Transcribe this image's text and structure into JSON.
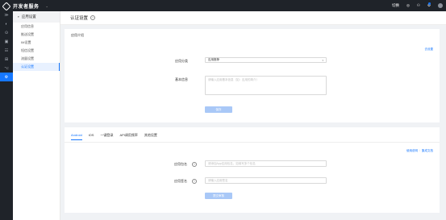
{
  "topbar": {
    "app_title": "开发者服务",
    "project_chevron": "⌄",
    "right_items": [
      "切换",
      "◎",
      "⚇",
      "⚙",
      "◍"
    ]
  },
  "rail": {
    "icons": [
      "≫",
      "◐",
      "⊙",
      "▣",
      "☷",
      "⊞",
      "⌥",
      "⚙"
    ],
    "active_index": 7
  },
  "sidenav": {
    "header": "应用设置",
    "items": [
      "应用信息",
      "推送设置",
      "IM设置",
      "短信设置",
      "流量设置",
      "认证设置"
    ],
    "active_index": 5
  },
  "page": {
    "title": "认证设置",
    "help": "?"
  },
  "card1": {
    "title": "应用介绍",
    "top_right_link": "去设置",
    "category_label": "应用分类",
    "category_value": "应用推荐",
    "desc_label": "基本信息",
    "desc_placeholder": "请输入应用基本信息（如：应用的简介）",
    "save_button": "保存"
  },
  "card2": {
    "tabs": [
      "Android",
      "iOS",
      "一键登录",
      "API调用频率",
      "其他设置"
    ],
    "active_tab": 0,
    "links": [
      "使用说明",
      "/",
      "集成文档"
    ],
    "package_label": "应用包名",
    "package_placeholder": "请添加App应用包名，如填写多个包名",
    "signature_label": "应用签名",
    "signature_placeholder": "请输入应用签名",
    "submit_button": "提交审核"
  },
  "colors": {
    "accent": "#1677ff",
    "topbar": "#1f2329",
    "button_disabled": "#a9c8f7"
  }
}
